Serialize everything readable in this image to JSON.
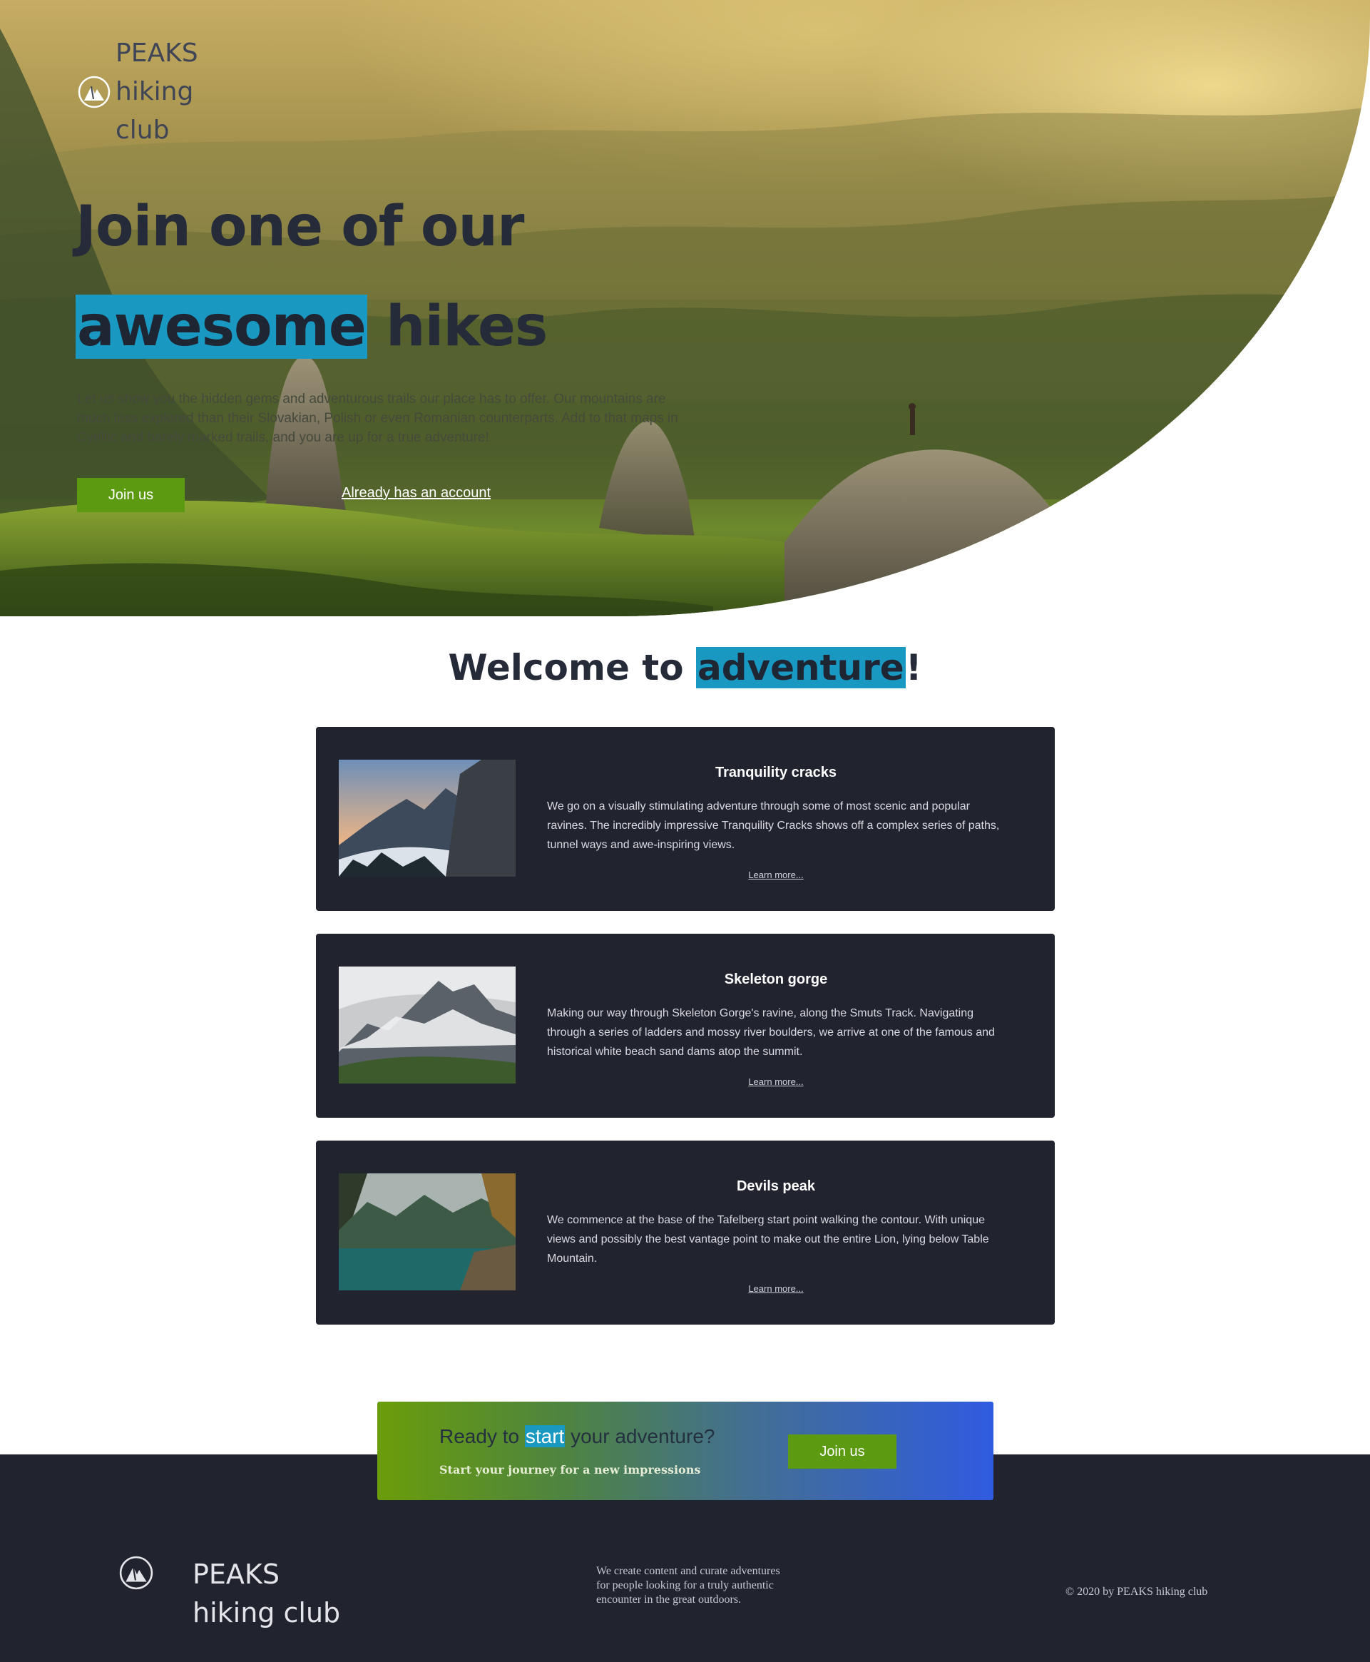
{
  "brand": {
    "logo_line1": "PEAKS",
    "logo_line2": "hiking",
    "logo_line3": "club",
    "icon": "mountain-circle-icon"
  },
  "hero": {
    "title_line1": "Join one of our",
    "title_highlight": "awesome",
    "title_rest": "hikes",
    "description": "Let us show you the hidden gems and adventurous trails our place has to offer. Our mountains are much less explored than their Slovakian, Polish or even Romanian counterparts. Add to that maps in Cyrillic and barely marked trails, and you are up for a true adventure!",
    "join_label": "Join us",
    "account_link": "Already has an account"
  },
  "welcome": {
    "prefix": "Welcome to ",
    "highlight": "adventure",
    "suffix": "!"
  },
  "cards": [
    {
      "title": "Tranquility cracks",
      "body": "We go on a visually stimulating adventure through some of most scenic and popular ravines. The incredibly impressive Tranquility Cracks shows off a complex series of paths, tunnel ways and awe-inspiring views.",
      "link": "Learn more..."
    },
    {
      "title": "Skeleton gorge",
      "body": "Making our way through Skeleton Gorge's ravine, along the Smuts Track. Navigating through a series of ladders and mossy river boulders, we arrive at one of the famous and historical white beach sand dams atop the summit.",
      "link": "Learn more..."
    },
    {
      "title": "Devils peak",
      "body": "We commence at the base of the Tafelberg start point walking the contour. With unique views and possibly the best vantage point to make out the entire Lion, lying below Table Mountain.",
      "link": "Learn more..."
    }
  ],
  "cta": {
    "prefix": "Ready to ",
    "highlight": "start",
    "suffix": " your adventure?",
    "subtitle": "Start your journey for a new impressions",
    "join_label": "Join us"
  },
  "footer": {
    "name_line1": "PEAKS",
    "name_line2": "hiking club",
    "about": "We create content and curate adventures for people looking for a truly authentic encounter in the great outdoors.",
    "copyright": "© 2020 by PEAKS hiking club"
  },
  "colors": {
    "accent": "#1998c1",
    "button": "#5c9b11",
    "dark": "#21232f",
    "text": "#262b3a"
  }
}
